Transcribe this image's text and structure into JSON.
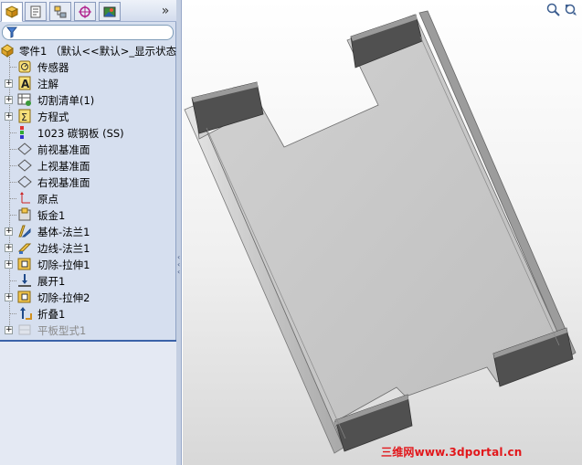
{
  "feature_tree": {
    "root": {
      "label": "零件1  （默认<<默认>_显示状态",
      "icon": "part-icon"
    },
    "items": [
      {
        "label": "传感器",
        "icon": "sensor-icon",
        "expandable": false
      },
      {
        "label": "注解",
        "icon": "annotation-icon",
        "expandable": true
      },
      {
        "label": "切割清单(1)",
        "icon": "cut-list-icon",
        "expandable": true
      },
      {
        "label": "方程式",
        "icon": "equations-icon",
        "expandable": true
      },
      {
        "label": "1023 碳钢板 (SS)",
        "icon": "material-icon",
        "expandable": false
      },
      {
        "label": "前视基准面",
        "icon": "plane-icon",
        "expandable": false
      },
      {
        "label": "上视基准面",
        "icon": "plane-icon",
        "expandable": false
      },
      {
        "label": "右视基准面",
        "icon": "plane-icon",
        "expandable": false
      },
      {
        "label": "原点",
        "icon": "origin-icon",
        "expandable": false
      },
      {
        "label": "钣金1",
        "icon": "sheet-metal-icon",
        "expandable": false
      },
      {
        "label": "基体-法兰1",
        "icon": "base-flange-icon",
        "expandable": true
      },
      {
        "label": "边线-法兰1",
        "icon": "edge-flange-icon",
        "expandable": true
      },
      {
        "label": "切除-拉伸1",
        "icon": "cut-extrude-icon",
        "expandable": true
      },
      {
        "label": "展开1",
        "icon": "unfold-icon",
        "expandable": false
      },
      {
        "label": "切除-拉伸2",
        "icon": "cut-extrude-icon",
        "expandable": true
      },
      {
        "label": "折叠1",
        "icon": "fold-icon",
        "expandable": false
      },
      {
        "label": "平板型式1",
        "icon": "flat-pattern-icon",
        "expandable": true,
        "suppressed": true
      }
    ]
  },
  "tabs": [
    {
      "name": "feature-manager",
      "icon": "feature-manager-icon",
      "active": true
    },
    {
      "name": "property-manager",
      "icon": "property-manager-icon",
      "active": false
    },
    {
      "name": "configuration-manager",
      "icon": "configuration-manager-icon",
      "active": false
    },
    {
      "name": "dim-xpert-manager",
      "icon": "dimxpert-icon",
      "active": false
    },
    {
      "name": "display-manager",
      "icon": "display-manager-icon",
      "active": false
    }
  ],
  "tab_expand_label": "»",
  "filter_icon": "filter-funnel-icon",
  "viewport": {
    "tools": [
      "zoom-icon",
      "view-orientation-icon"
    ],
    "watermark": "三维网www.3dportal.cn"
  },
  "colors": {
    "panel_bg": "#d6dfef",
    "selection_line": "#3b62a8",
    "sheet_face": "#c9c9c9",
    "sheet_edge": "#5a5a5a",
    "watermark": "#e2171b"
  }
}
